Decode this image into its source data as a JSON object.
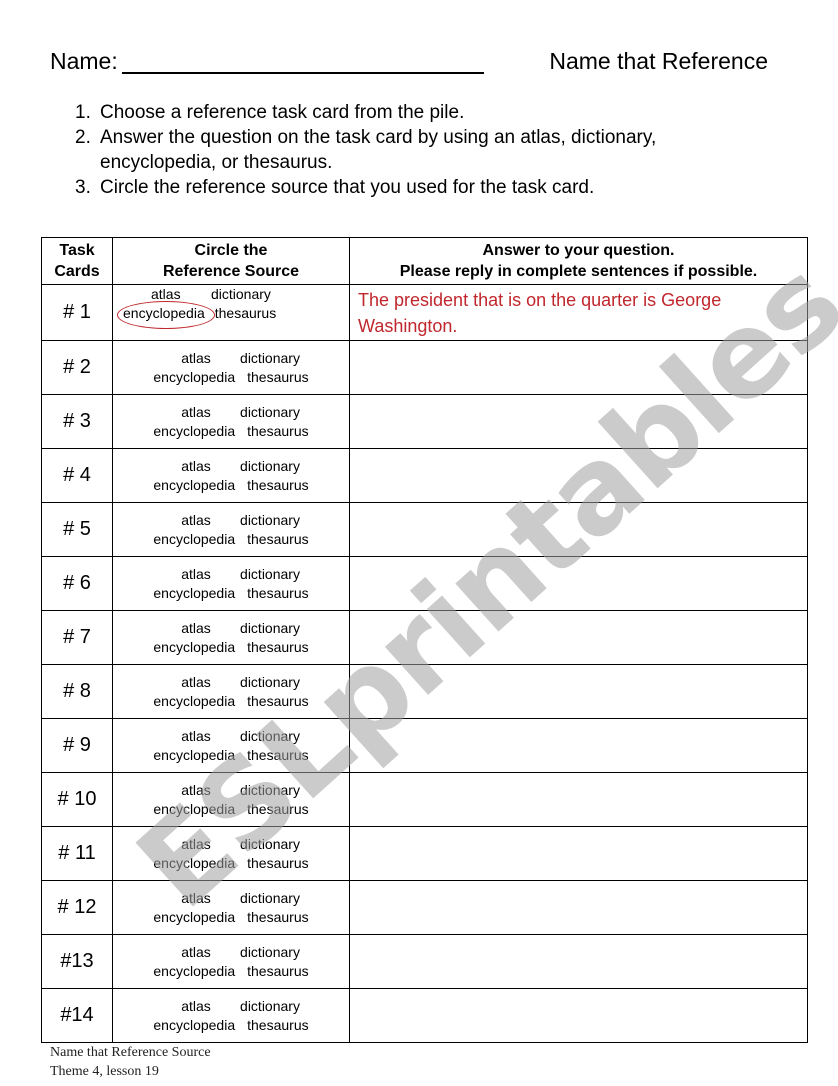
{
  "header": {
    "name_label": "Name:",
    "title": "Name that Reference"
  },
  "instructions": [
    {
      "num": "1.",
      "text": "Choose a reference task card from the pile."
    },
    {
      "num": "2.",
      "text": "Answer the question on the task card by using an atlas, dictionary, encyclopedia, or thesaurus."
    },
    {
      "num": "3.",
      "text": "Circle the reference source that you used for the task card."
    }
  ],
  "table": {
    "headers": {
      "col1_line1": "Task",
      "col1_line2": "Cards",
      "col2_line1": "Circle the",
      "col2_line2": "Reference Source",
      "col3_line1": "Answer to your question.",
      "col3_line2": "Please reply in complete sentences if possible."
    },
    "sources": {
      "atlas": "atlas",
      "dictionary": "dictionary",
      "encyclopedia": "encyclopedia",
      "thesaurus": "thesaurus"
    },
    "rows": [
      {
        "card": "# 1",
        "circled": "encyclopedia",
        "answer": "The president that is on the quarter is George Washington."
      },
      {
        "card": "# 2",
        "answer": ""
      },
      {
        "card": "# 3",
        "answer": ""
      },
      {
        "card": "# 4",
        "answer": ""
      },
      {
        "card": "# 5",
        "answer": ""
      },
      {
        "card": "# 6",
        "answer": ""
      },
      {
        "card": "# 7",
        "answer": ""
      },
      {
        "card": "# 8",
        "answer": ""
      },
      {
        "card": "# 9",
        "answer": ""
      },
      {
        "card": "# 10",
        "answer": ""
      },
      {
        "card": "# 11",
        "answer": ""
      },
      {
        "card": "# 12",
        "answer": ""
      },
      {
        "card": "#13",
        "answer": ""
      },
      {
        "card": "#14",
        "answer": ""
      }
    ]
  },
  "colors": {
    "answer_text": "#c0272d",
    "circle_mark": "#c0272d",
    "watermark": "#a0a0a0"
  },
  "footer": {
    "line1": "Name that Reference Source",
    "line2": "Theme 4, lesson 19"
  },
  "watermark": "ESLprintables.com"
}
